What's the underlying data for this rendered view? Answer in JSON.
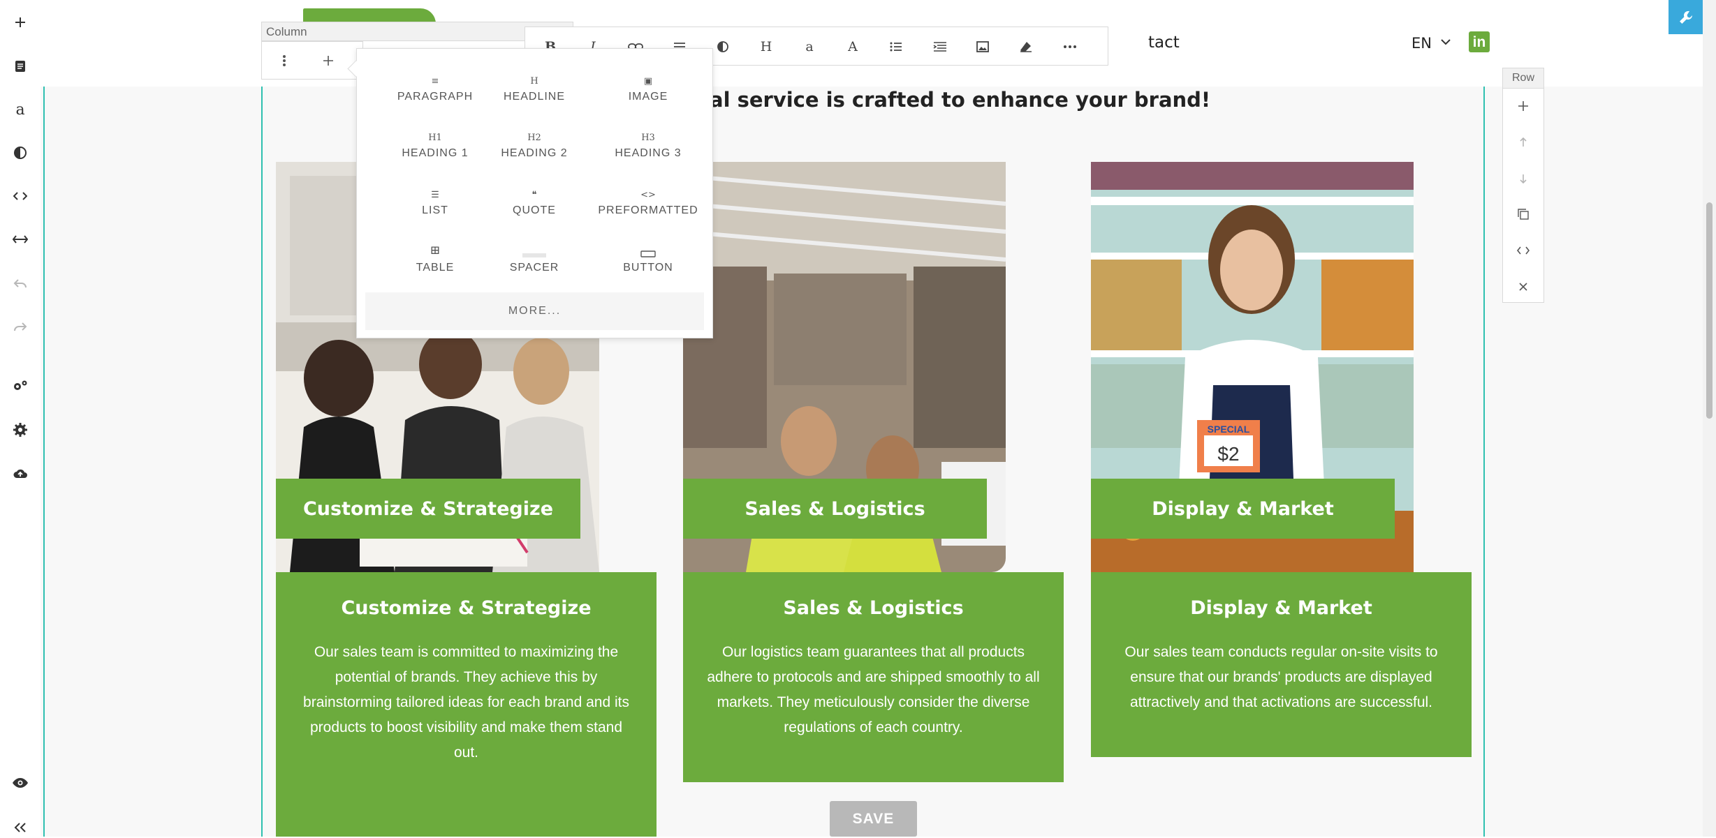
{
  "header": {
    "nav_partial": "tact",
    "language": "EN"
  },
  "tagline": "al service is crafted to enhance your brand!",
  "column_panel": {
    "label": "Column"
  },
  "row_panel": {
    "label": "Row"
  },
  "format_toolbar": {
    "items": [
      {
        "icon": "bold-icon",
        "glyph": "B"
      },
      {
        "icon": "italic-icon",
        "glyph": "I"
      },
      {
        "icon": "link-icon",
        "glyph": ""
      },
      {
        "icon": "align-icon",
        "glyph": ""
      },
      {
        "icon": "contrast-icon",
        "glyph": ""
      },
      {
        "icon": "heading-icon",
        "glyph": "H"
      },
      {
        "icon": "font-small-icon",
        "glyph": "a"
      },
      {
        "icon": "font-large-icon",
        "glyph": "A"
      },
      {
        "icon": "list-icon",
        "glyph": ""
      },
      {
        "icon": "indent-icon",
        "glyph": ""
      },
      {
        "icon": "image-icon",
        "glyph": ""
      },
      {
        "icon": "clear-format-icon",
        "glyph": ""
      },
      {
        "icon": "more-icon",
        "glyph": ""
      }
    ]
  },
  "insert_menu": {
    "items": [
      {
        "label": "PARAGRAPH",
        "glyph": "≡"
      },
      {
        "label": "HEADLINE",
        "glyph": "H"
      },
      {
        "label": "IMAGE",
        "glyph": "▣"
      },
      {
        "label": "HEADING 1",
        "glyph": "H1"
      },
      {
        "label": "HEADING 2",
        "glyph": "H2"
      },
      {
        "label": "HEADING 3",
        "glyph": "H3"
      },
      {
        "label": "LIST",
        "glyph": "☰"
      },
      {
        "label": "QUOTE",
        "glyph": "❝"
      },
      {
        "label": "PREFORMATTED",
        "glyph": "<>"
      },
      {
        "label": "TABLE",
        "glyph": "⊞"
      },
      {
        "label": "SPACER",
        "glyph": ""
      },
      {
        "label": "BUTTON",
        "glyph": ""
      }
    ],
    "more_label": "MORE..."
  },
  "cards": [
    {
      "caption": "Customize & Strategize",
      "title": "Customize & Strategize",
      "text": "Our sales team is committed to maximizing the potential of brands. They achieve this by brainstorming tailored ideas for each brand and its products to boost visibility and make them stand out."
    },
    {
      "caption": "Sales & Logistics",
      "title": "Sales & Logistics",
      "text": "Our logistics team guarantees that all products adhere to protocols and are shipped smoothly to all markets. They meticulously consider the diverse regulations of each country."
    },
    {
      "caption": "Display & Market",
      "title": "Display & Market",
      "text": "Our sales team conducts regular on-site visits to ensure that our brands' products are displayed attractively and that activations are successful."
    }
  ],
  "price_sign": {
    "title": "SPECIAL",
    "price": "$2"
  },
  "save_label": "SAVE",
  "colors": {
    "brand_green": "#6cab3d",
    "frame_teal": "#2fc0b0",
    "tool_blue": "#39a9dc",
    "save_gray": "#b8b8b8"
  }
}
